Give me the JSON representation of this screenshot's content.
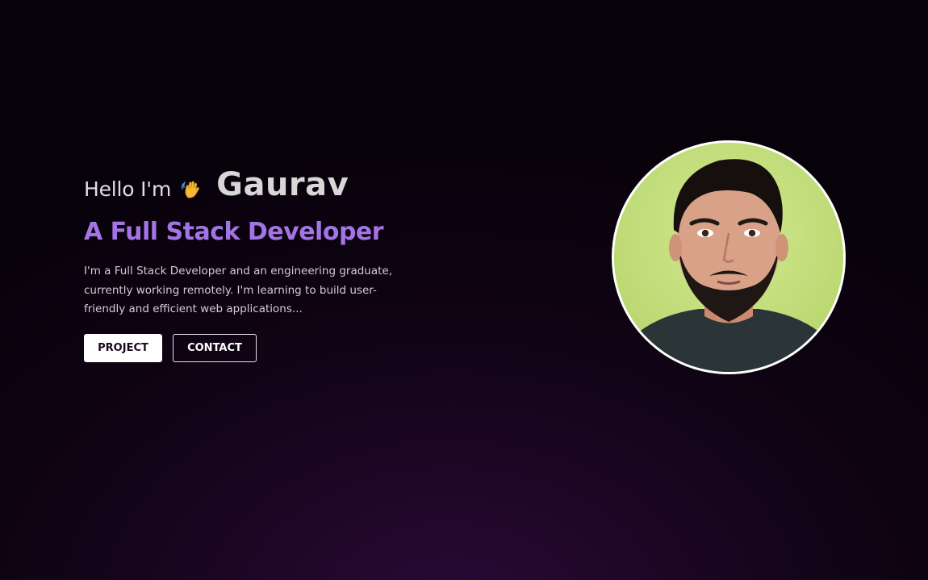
{
  "hero": {
    "greeting": "Hello I'm",
    "wave_icon": "waving-hand-icon",
    "name": "Gaurav",
    "role": "A Full Stack Developer",
    "description": "I'm a Full Stack Developer and an engineering graduate, currently working remotely. I'm learning to build user-friendly and efficient web applications...",
    "buttons": {
      "project": "PROJECT",
      "contact": "CONTACT"
    },
    "avatar_icon": "profile-photo"
  },
  "colors": {
    "background": "#0e0312",
    "accent": "#a474e6",
    "name": "#d7d7d7",
    "text": "#d4ccd6"
  }
}
